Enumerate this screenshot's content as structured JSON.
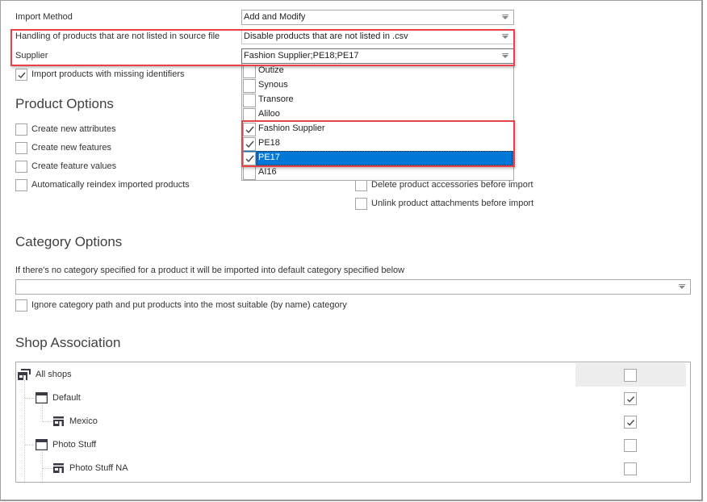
{
  "import_settings": {
    "import_method": {
      "label": "Import Method",
      "value": "Add and Modify"
    },
    "handling": {
      "label": "Handling of products that are not listed in source file",
      "value": "Disable products that are not listed in .csv"
    },
    "supplier": {
      "label": "Supplier",
      "value": "Fashion Supplier;PE18;PE17",
      "options": [
        {
          "label": "Outize",
          "checked": false,
          "selected": false
        },
        {
          "label": "Synous",
          "checked": false,
          "selected": false
        },
        {
          "label": "Transore",
          "checked": false,
          "selected": false
        },
        {
          "label": "Aliloo",
          "checked": false,
          "selected": false
        },
        {
          "label": "Fashion Supplier",
          "checked": true,
          "selected": false
        },
        {
          "label": "PE18",
          "checked": true,
          "selected": false
        },
        {
          "label": "PE17",
          "checked": true,
          "selected": true
        },
        {
          "label": "AI16",
          "checked": false,
          "selected": false
        }
      ]
    },
    "missing_identifiers": {
      "label": "Import products with missing identifiers",
      "checked": true
    }
  },
  "product_options": {
    "title": "Product Options",
    "left": [
      {
        "label": "Create new attributes",
        "checked": false
      },
      {
        "label": "Create new features",
        "checked": false
      },
      {
        "label": "Create feature values",
        "checked": false
      },
      {
        "label": "Automatically reindex imported products",
        "checked": false
      }
    ],
    "right": [
      {
        "label": "Delete product accessories before import",
        "checked": false
      },
      {
        "label": "Unlink product attachments before import",
        "checked": false
      }
    ]
  },
  "category_options": {
    "title": "Category Options",
    "description": "If there's no category specified for a product it will be imported into default category specified below",
    "default_category": "",
    "ignore_path": {
      "label": "Ignore category path and put products into the most suitable (by name) category",
      "checked": false
    }
  },
  "shop_association": {
    "title": "Shop Association",
    "tree": [
      {
        "label": "All shops",
        "icon": "shop-group-icon",
        "level": 0,
        "checked": false
      },
      {
        "label": "Default",
        "icon": "shop-window-icon",
        "level": 1,
        "checked": true
      },
      {
        "label": "Mexico",
        "icon": "store-icon",
        "level": 2,
        "checked": true
      },
      {
        "label": "Photo Stuff",
        "icon": "shop-window-icon",
        "level": 1,
        "checked": false
      },
      {
        "label": "Photo Stuff NA",
        "icon": "store-icon",
        "level": 2,
        "checked": false
      }
    ]
  },
  "colors": {
    "highlight": "#e8414a",
    "selection": "#0078d7"
  }
}
